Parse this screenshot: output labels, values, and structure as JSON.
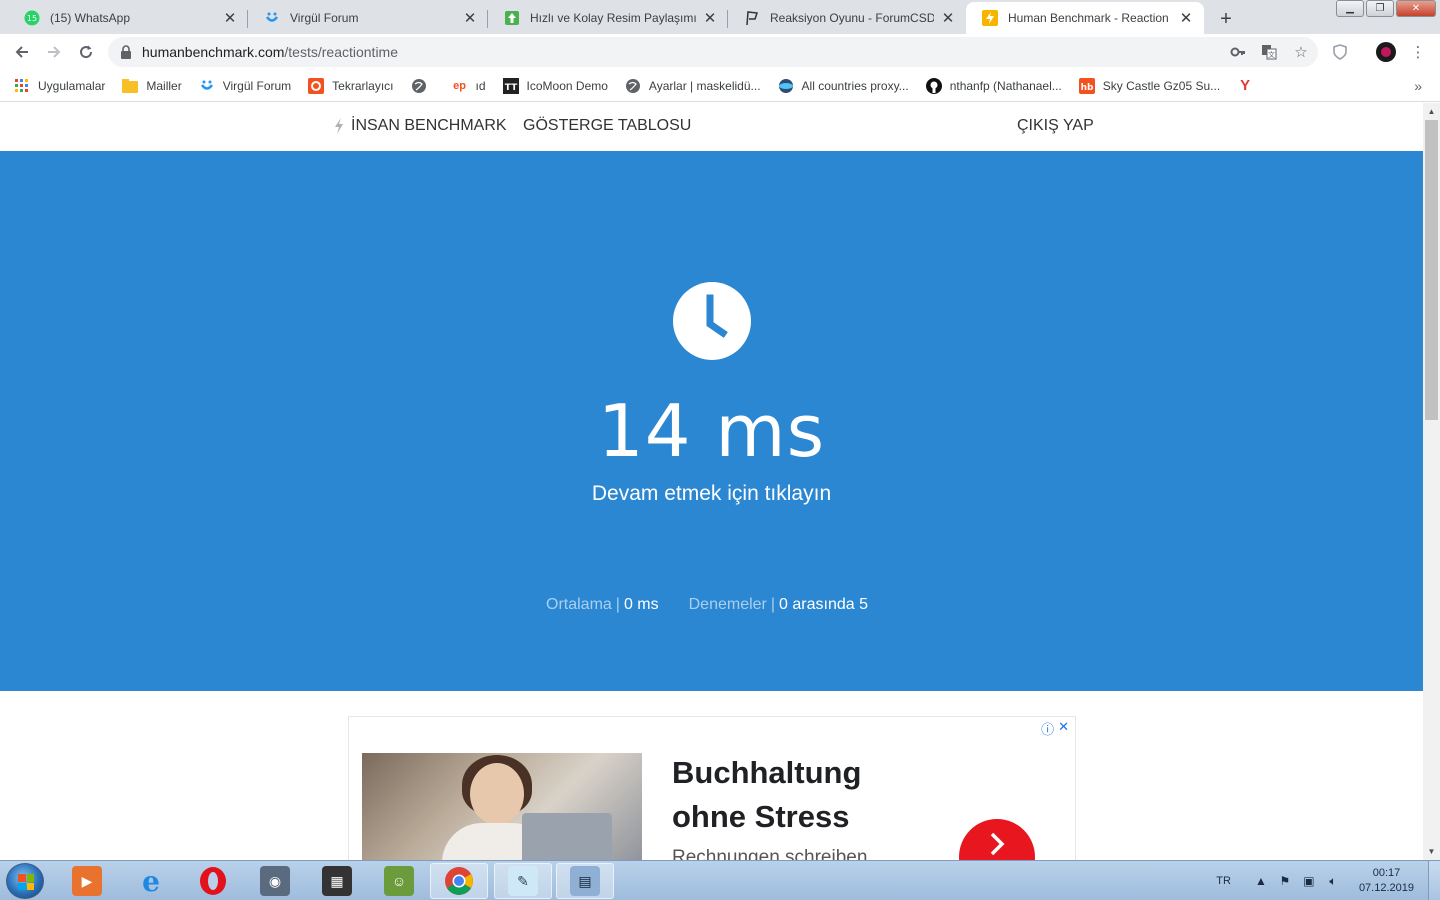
{
  "browser": {
    "tabs": [
      {
        "title": "(15) WhatsApp",
        "badge": "15",
        "active": false
      },
      {
        "title": "Virgül Forum",
        "active": false
      },
      {
        "title": "Hızlı ve Kolay Resim Paylaşımı - r",
        "active": false
      },
      {
        "title": "Reaksiyon Oyunu - ForumCSDark",
        "active": false
      },
      {
        "title": "Human Benchmark - Reaction Tin",
        "active": true
      }
    ],
    "new_tab_label": "+",
    "url_host": "humanbenchmark.com",
    "url_path": "/tests/reactiontime",
    "bookmarks": [
      {
        "label": "Uygulamalar",
        "icon": "apps-grid-icon"
      },
      {
        "label": "Mailler",
        "icon": "folder-icon"
      },
      {
        "label": "Virgül Forum",
        "icon": "virgul-icon"
      },
      {
        "label": "Tekrarlayıcı",
        "icon": "repeat-icon"
      },
      {
        "label": "",
        "icon": "globe-icon"
      },
      {
        "label": "ıd",
        "icon": "ep-icon"
      },
      {
        "label": "IcoMoon Demo",
        "icon": "icomoon-icon"
      },
      {
        "label": "Ayarlar | maskelidü...",
        "icon": "globe-icon"
      },
      {
        "label": "All countries proxy...",
        "icon": "proxy-icon"
      },
      {
        "label": "nthanfp (Nathanael...",
        "icon": "github-icon"
      },
      {
        "label": "Sky Castle Gz05 Su...",
        "icon": "hb-icon"
      },
      {
        "label": "",
        "icon": "yandex-icon"
      }
    ],
    "bookmarks_more": "»"
  },
  "site": {
    "brand": "İNSAN BENCHMARK",
    "dashboard": "GÖSTERGE TABLOSU",
    "logout": "ÇIKIŞ YAP"
  },
  "test": {
    "result": "14 ms",
    "prompt": "Devam etmek için tıklayın",
    "average_label": "Ortalama",
    "average_value": "0 ms",
    "attempts_label": "Denemeler",
    "attempts_value": "0 arasında 5",
    "accent_color": "#2b87d1"
  },
  "ad": {
    "headline_line1": "Buchhaltung",
    "headline_line2": "ohne Stress",
    "sub": "Rechnungen schreiben"
  },
  "taskbar": {
    "lang": "TR",
    "time": "00:17",
    "date": "07.12.2019"
  }
}
